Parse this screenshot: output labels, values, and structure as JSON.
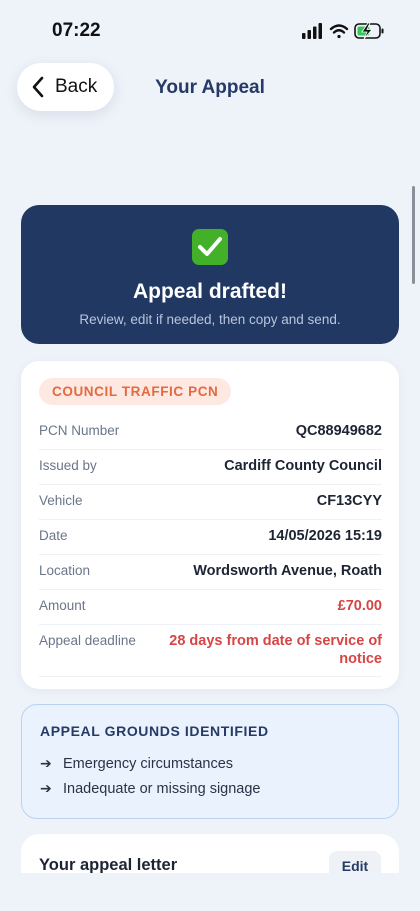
{
  "status_bar": {
    "time": "07:22"
  },
  "nav": {
    "back_label": "Back",
    "title": "Your Appeal"
  },
  "hero": {
    "title": "Appeal drafted!",
    "subtitle": "Review, edit if needed, then copy and send."
  },
  "pcn": {
    "badge": "COUNCIL TRAFFIC PCN",
    "rows": [
      {
        "label": "PCN Number",
        "value": "QC88949682"
      },
      {
        "label": "Issued by",
        "value": "Cardiff County Council"
      },
      {
        "label": "Vehicle",
        "value": "CF13CYY"
      },
      {
        "label": "Date",
        "value": "14/05/2026 15:19"
      },
      {
        "label": "Location",
        "value": "Wordsworth Avenue, Roath"
      },
      {
        "label": "Amount",
        "value": "£70.00"
      },
      {
        "label": "Appeal deadline",
        "value": "28 days from date of service of notice"
      }
    ]
  },
  "grounds": {
    "title": "APPEAL GROUNDS IDENTIFIED",
    "items": [
      "Emergency circumstances",
      "Inadequate or missing signage"
    ]
  },
  "letter": {
    "title": "Your appeal letter",
    "edit_label": "Edit"
  },
  "colors": {
    "hero_bg": "#213863",
    "badge_text": "#e5683f",
    "alert_red": "#d64545",
    "accent_navy": "#253a66",
    "check_green": "#43b02a"
  }
}
